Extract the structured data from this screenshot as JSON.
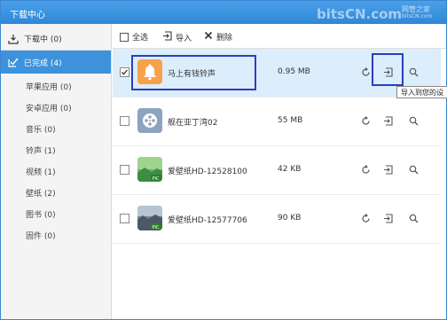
{
  "window": {
    "title": "下载中心",
    "watermark": "bitsCN.com",
    "watermark_sub": "网管之家",
    "watermark_sub2": "bitsCN.com"
  },
  "sidebar": {
    "downloading": "下载中 (0)",
    "completed": "已完成 (4)",
    "categories": [
      "苹果应用 (0)",
      "安卓应用 (0)",
      "音乐 (0)",
      "铃声 (1)",
      "视频 (1)",
      "壁纸 (2)",
      "图书 (0)",
      "固件 (0)"
    ]
  },
  "toolbar": {
    "select_all": "全选",
    "import": "导入",
    "delete": "删除"
  },
  "rows": [
    {
      "name": "马上有钱铃声",
      "size": "0.95 MB",
      "checked": true,
      "thumb": "bell-icon"
    },
    {
      "name": "舰在亚丁湾02",
      "size": "55 MB",
      "checked": false,
      "thumb": "video-reel-icon"
    },
    {
      "name": "爱壁纸HD-12528100",
      "size": "42 KB",
      "checked": false,
      "thumb": "wallpaper-thumb"
    },
    {
      "name": "爱壁纸HD-12577706",
      "size": "90 KB",
      "checked": false,
      "thumb": "wallpaper-thumb"
    }
  ],
  "tooltip": "导入到您的设",
  "pic_badge": "PIC",
  "colors": {
    "titlebar": "#3a8fdc",
    "selected_nav": "#3e92dc",
    "selected_row": "#dcedfb",
    "highlight_box": "#2a3fbf"
  }
}
